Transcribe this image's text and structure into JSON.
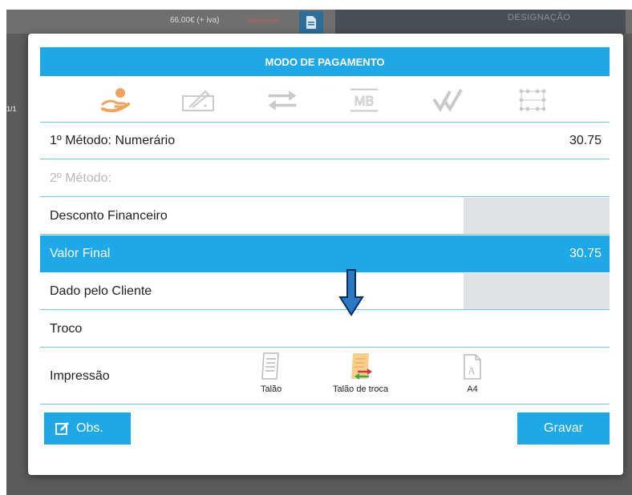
{
  "background": {
    "price": "66.00€ (+ iva)",
    "unavailable": "Indisponível",
    "column_header": "DESIGNAÇÃO",
    "page_info": "1/1"
  },
  "modal": {
    "title": "MODO DE PAGAMENTO",
    "payment_methods": [
      {
        "name": "cash-hand-icon",
        "selected": true
      },
      {
        "name": "check-sign-icon",
        "selected": false
      },
      {
        "name": "transfer-arrows-icon",
        "selected": false
      },
      {
        "name": "multibanco-icon",
        "text": "MB",
        "selected": false
      },
      {
        "name": "double-check-icon",
        "selected": false
      },
      {
        "name": "grid-dots-icon",
        "selected": false
      }
    ],
    "rows": {
      "method1": {
        "label": "1º Método: Numerário",
        "value": "30.75"
      },
      "method2": {
        "label": "2º Método:",
        "value": ""
      },
      "discount": {
        "label": "Desconto Financeiro"
      },
      "final": {
        "label": "Valor Final",
        "value": "30.75"
      },
      "given": {
        "label": "Dado pelo Cliente"
      },
      "change": {
        "label": "Troco"
      },
      "print": {
        "label": "Impressão"
      }
    },
    "print_options": [
      {
        "label": "Talão",
        "selected": false
      },
      {
        "label": "Talão de troca",
        "selected": true
      },
      {
        "label": "A4",
        "selected": false
      }
    ],
    "buttons": {
      "obs": "Obs.",
      "save": "Gravar"
    }
  },
  "colors": {
    "accent": "#1ea8e8",
    "arrow": "#2b78c5",
    "disabled_box": "#dfe2e4"
  }
}
